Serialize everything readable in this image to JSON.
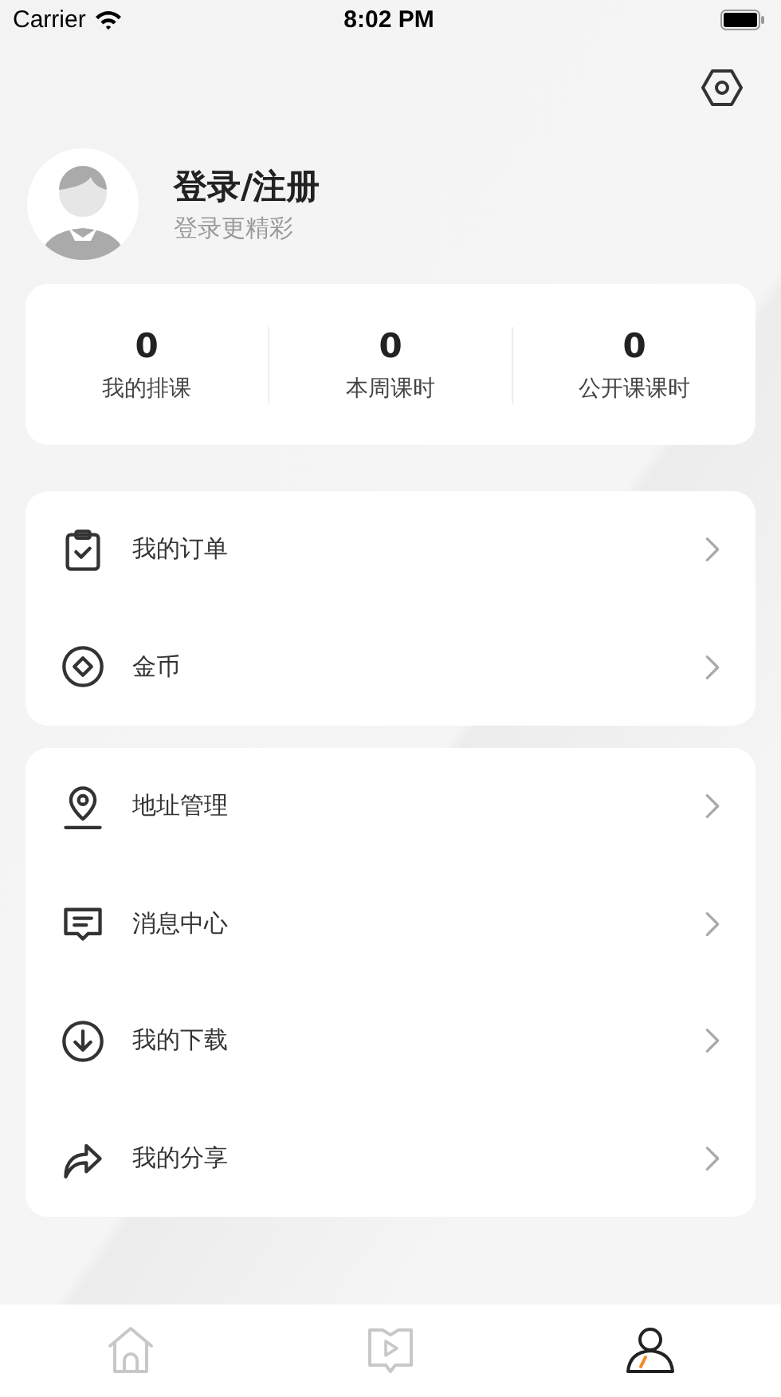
{
  "status_bar": {
    "carrier": "Carrier",
    "time": "8:02 PM"
  },
  "profile": {
    "name": "登录/注册",
    "subtitle": "登录更精彩"
  },
  "stats": [
    {
      "value": "0",
      "label": "我的排课"
    },
    {
      "value": "0",
      "label": "本周课时"
    },
    {
      "value": "0",
      "label": "公开课课时"
    }
  ],
  "menu_groups": [
    [
      {
        "kind": "order",
        "label": "我的订单"
      },
      {
        "kind": "coin",
        "label": "金币"
      }
    ],
    [
      {
        "kind": "address",
        "label": "地址管理"
      },
      {
        "kind": "message",
        "label": "消息中心"
      },
      {
        "kind": "download",
        "label": "我的下载"
      },
      {
        "kind": "share",
        "label": "我的分享"
      }
    ]
  ],
  "tab_bar": [
    {
      "kind": "home",
      "selected": false
    },
    {
      "kind": "video",
      "selected": false
    },
    {
      "kind": "profile",
      "selected": true
    }
  ]
}
